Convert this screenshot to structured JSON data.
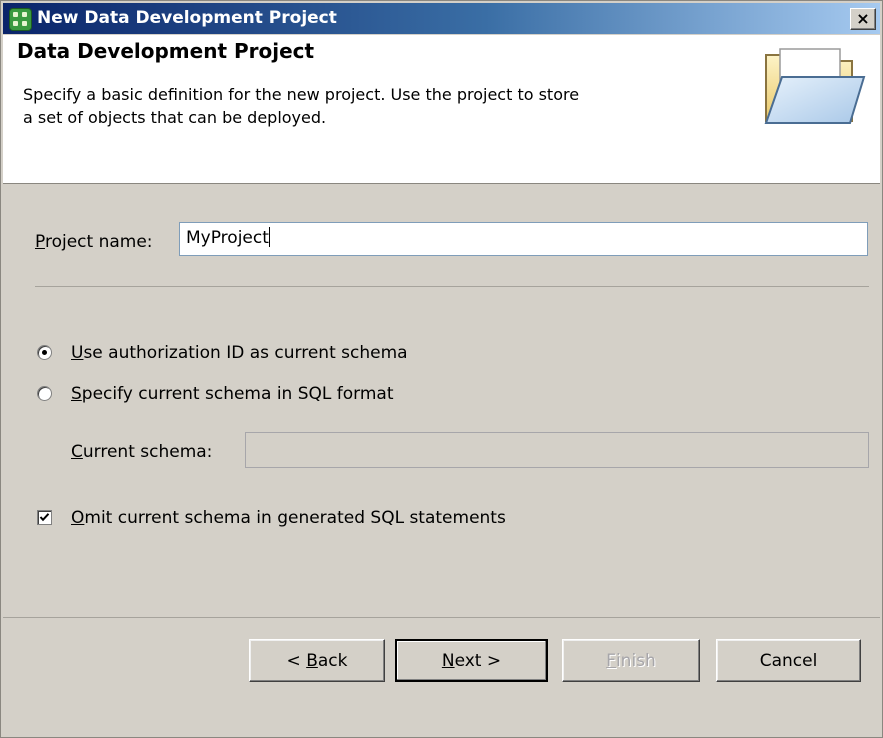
{
  "window": {
    "title": "New Data Development Project",
    "close_label": "×"
  },
  "header": {
    "title": "Data Development Project",
    "description_line1": "Specify a basic definition for the new project.  Use the project to store",
    "description_line2": "a set of objects that can be deployed.",
    "icon": "open-folder-icon"
  },
  "form": {
    "project_name_label_mnemonic": "P",
    "project_name_label_rest": "roject name:",
    "project_name_value": "MyProject",
    "radio_auth": {
      "mnemonic": "U",
      "rest": "se authorization ID as current schema",
      "selected": true
    },
    "radio_specify": {
      "mnemonic": "S",
      "rest": "pecify current schema in SQL format",
      "selected": false
    },
    "current_schema_label_mnemonic": "C",
    "current_schema_label_rest": "urrent schema:",
    "current_schema_value": "",
    "omit_checkbox": {
      "mnemonic": "O",
      "rest": "mit current schema in generated SQL statements",
      "checked": true
    }
  },
  "buttons": {
    "back_prefix": "< ",
    "back_mnemonic": "B",
    "back_rest": "ack",
    "next_mnemonic": "N",
    "next_rest": "ext >",
    "finish_mnemonic": "F",
    "finish_rest": "inish",
    "cancel": "Cancel"
  },
  "colors": {
    "titlebar_start": "#0a246a",
    "titlebar_end": "#a6caf0",
    "dialog_bg": "#d4d0c8"
  }
}
